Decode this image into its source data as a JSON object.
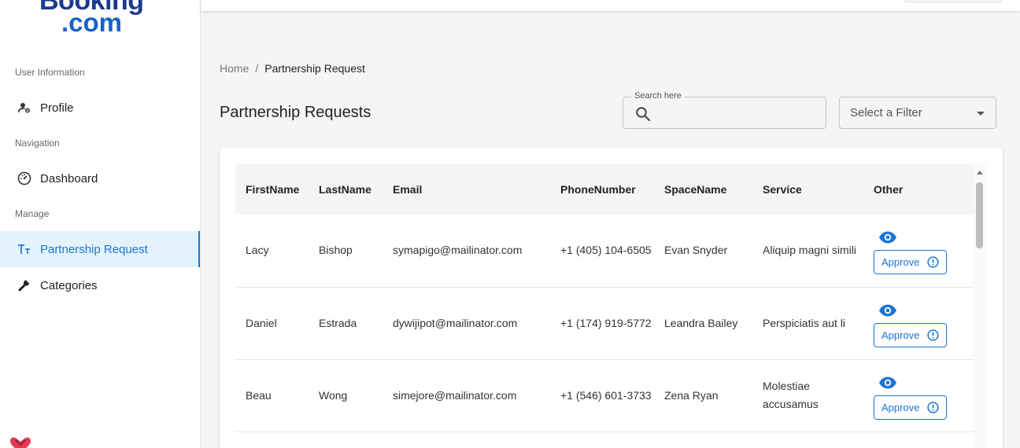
{
  "brand": {
    "line1": "Booking",
    "line2": ".com",
    "color": "#1b3a8c"
  },
  "sidebar": {
    "sections": [
      {
        "label": "User Information"
      },
      {
        "label": "Navigation"
      },
      {
        "label": "Manage"
      }
    ],
    "items": [
      {
        "label": "Profile",
        "icon": "user-settings-icon"
      },
      {
        "label": "Dashboard",
        "icon": "dashboard-icon"
      },
      {
        "label": "Partnership Request",
        "icon": "text-fields-icon",
        "active": true
      },
      {
        "label": "Categories",
        "icon": "wrench-icon"
      }
    ]
  },
  "breadcrumb": {
    "home": "Home",
    "separator": "/",
    "current": "Partnership Request"
  },
  "page": {
    "title": "Partnership Requests"
  },
  "search": {
    "label": "Search here",
    "value": ""
  },
  "filter": {
    "placeholder": "Select a Filter"
  },
  "table": {
    "columns": [
      "FirstName",
      "LastName",
      "Email",
      "PhoneNumber",
      "SpaceName",
      "Service",
      "Other"
    ],
    "rows": [
      {
        "first": "Lacy",
        "last": "Bishop",
        "email": "symapigo@mailinator.com",
        "phone": "+1 (405) 104-6505",
        "space": "Evan Snyder",
        "service": "Aliquip magni simili",
        "action": "Approve"
      },
      {
        "first": "Daniel",
        "last": "Estrada",
        "email": "dywijipot@mailinator.com",
        "phone": "+1 (174) 919-5772",
        "space": "Leandra Bailey",
        "service": "Perspiciatis aut li",
        "action": "Approve"
      },
      {
        "first": "Beau",
        "last": "Wong",
        "email": "simejore@mailinator.com",
        "phone": "+1 (546) 601-3733",
        "space": "Zena Ryan",
        "service": "Molestiae accusamus",
        "action": "Approve"
      }
    ]
  },
  "colors": {
    "accent": "#1976d2",
    "active_bg": "#e3f2fd"
  }
}
